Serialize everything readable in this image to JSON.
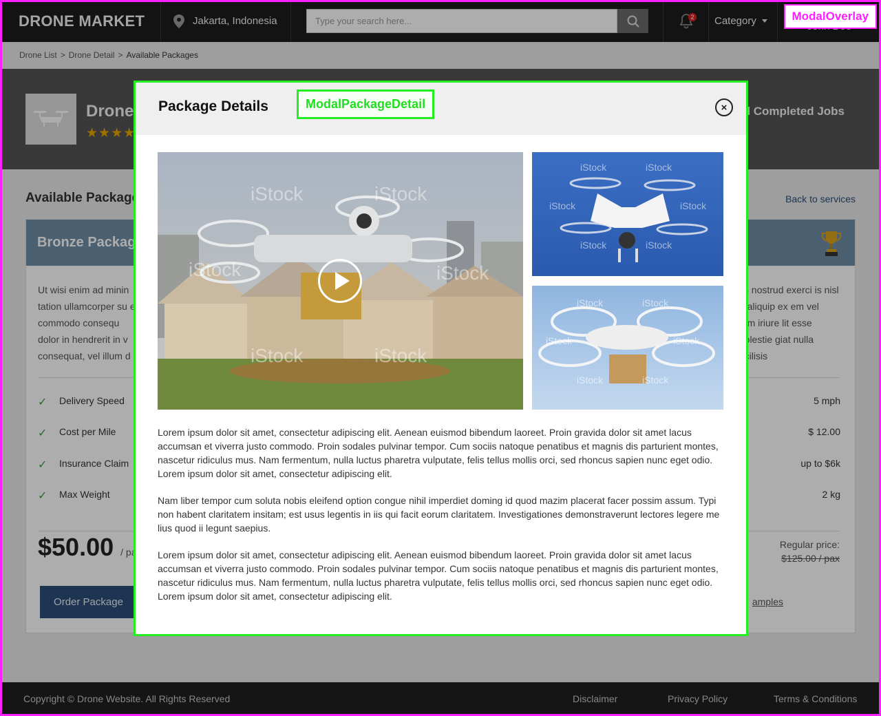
{
  "header": {
    "brand": "DRONE MARKET",
    "location": "Jakarta, Indonesia",
    "search_placeholder": "Type your search here...",
    "notification_count": "2",
    "category_label": "Category",
    "user_name": "John Doe"
  },
  "breadcrumb": {
    "items": [
      "Drone List",
      ">",
      "Drone Detail",
      ">",
      "Available Packages"
    ]
  },
  "hero": {
    "title": "Drone",
    "stars": "★★★★",
    "right_text": "al Completed Jobs"
  },
  "section": {
    "title": "Available Package",
    "back_link": "Back to services"
  },
  "package_card": {
    "name": "Bronze Packag",
    "desc_left": "Ut wisi enim ad minin tation ullamcorper su ea commodo consequ dolor in hendrerit in v consequat, vel illum d",
    "desc_right": "uis nostrud exerci is nisl ut aliquip ex em vel eum iriure lit esse molestie giat nulla facilisis",
    "features": [
      {
        "label": "Delivery Speed",
        "value": "5 mph"
      },
      {
        "label": "Cost per Mile",
        "value": "$ 12.00"
      },
      {
        "label": "Insurance Claim",
        "value": "up to $6k"
      },
      {
        "label": "Max Weight",
        "value": "2 kg"
      }
    ],
    "price": "$50.00",
    "price_unit": "/ pa",
    "regular_label": "Regular price:",
    "regular_price": "$125.00 / pax",
    "order_button": "Order Package",
    "samples_link": "amples"
  },
  "footer": {
    "copyright": "Copyright © Drone Website. All Rights Reserved",
    "links": [
      "Disclaimer",
      "Privacy Policy",
      "Terms & Conditions"
    ]
  },
  "overlay_tag": "ModalOverlay",
  "modal": {
    "title": "Package Details",
    "tag": "ModalPackageDetail",
    "close_icon": "×",
    "paragraphs": [
      "Lorem ipsum dolor sit amet, consectetur adipiscing elit. Aenean euismod bibendum laoreet. Proin gravida dolor sit amet lacus accumsan et viverra justo commodo. Proin sodales pulvinar tempor. Cum sociis natoque penatibus et magnis dis parturient montes, nascetur ridiculus mus. Nam fermentum, nulla luctus pharetra vulputate, felis tellus mollis orci, sed rhoncus sapien nunc eget odio. Lorem ipsum dolor sit amet, consectetur adipiscing elit.",
      "Nam liber tempor cum soluta nobis eleifend option congue nihil imperdiet doming id quod mazim placerat facer possim assum. Typi non habent claritatem insitam; est usus legentis in iis qui facit eorum claritatem. Investigationes demonstraverunt lectores legere me lius quod ii legunt saepius.",
      "Lorem ipsum dolor sit amet, consectetur adipiscing elit. Aenean euismod bibendum laoreet. Proin gravida dolor sit amet lacus accumsan et viverra justo commodo. Proin sodales pulvinar tempor. Cum sociis natoque penatibus et magnis dis parturient montes, nascetur ridiculus mus. Nam fermentum, nulla luctus pharetra vulputate, felis tellus mollis orci, sed rhoncus sapien nunc eget odio. Lorem ipsum dolor sit amet, consectetur adipiscing elit."
    ],
    "watermark": "iStock"
  },
  "colors": {
    "overlay_outline": "#ff20ff",
    "modal_outline": "#22ee22",
    "primary": "#2b4f7a",
    "card_header": "#6f8ea6",
    "star": "#e8a500"
  },
  "icons": [
    "location-pin-icon",
    "search-icon",
    "bell-icon",
    "caret-down-icon",
    "drone-icon",
    "star-icon",
    "trophy-icon",
    "check-icon",
    "close-icon",
    "play-icon"
  ]
}
